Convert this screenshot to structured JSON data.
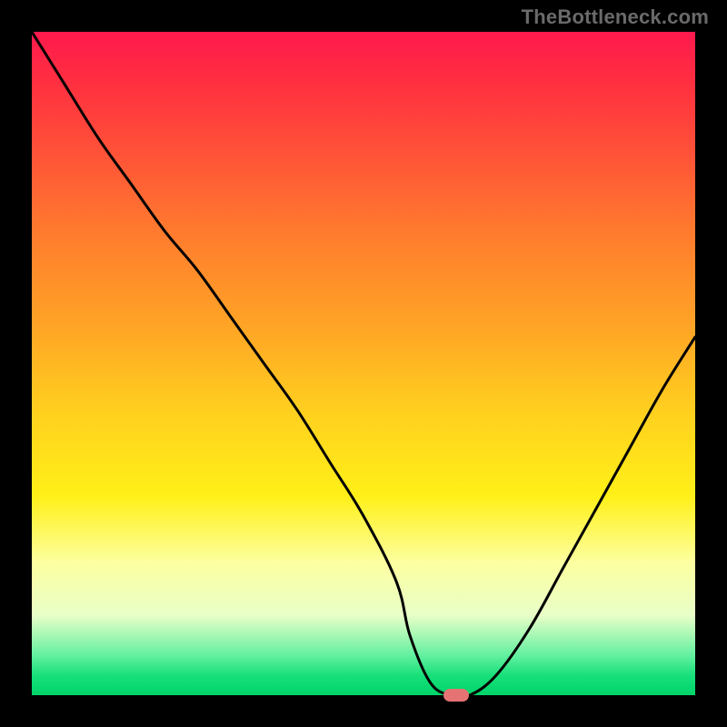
{
  "watermark": "TheBottleneck.com",
  "colors": {
    "frame": "#000000",
    "marker": "#e57373",
    "curve": "#000000",
    "gradient_top": "#ff1a4d",
    "gradient_bottom": "#00d46a"
  },
  "chart_data": {
    "type": "line",
    "title": "",
    "xlabel": "",
    "ylabel": "",
    "xlim": [
      0,
      100
    ],
    "ylim": [
      0,
      100
    ],
    "x": [
      0,
      5,
      10,
      15,
      20,
      25,
      30,
      35,
      40,
      45,
      50,
      55,
      57,
      60,
      63,
      66,
      70,
      75,
      80,
      85,
      90,
      95,
      100
    ],
    "y": [
      100,
      92,
      84,
      77,
      70,
      64,
      57,
      50,
      43,
      35,
      27,
      17,
      9,
      2,
      0,
      0,
      3,
      10,
      19,
      28,
      37,
      46,
      54
    ],
    "marker": {
      "x": 64,
      "y": 0
    },
    "notes": "Values are approximate readings from the plotted curve; axes have no tick labels so a 0–100 normalized scale is assumed. Curve descends steeply from top-left, bottoms out near x≈63–66 at y≈0, then rises toward the right edge ending near y≈54."
  }
}
